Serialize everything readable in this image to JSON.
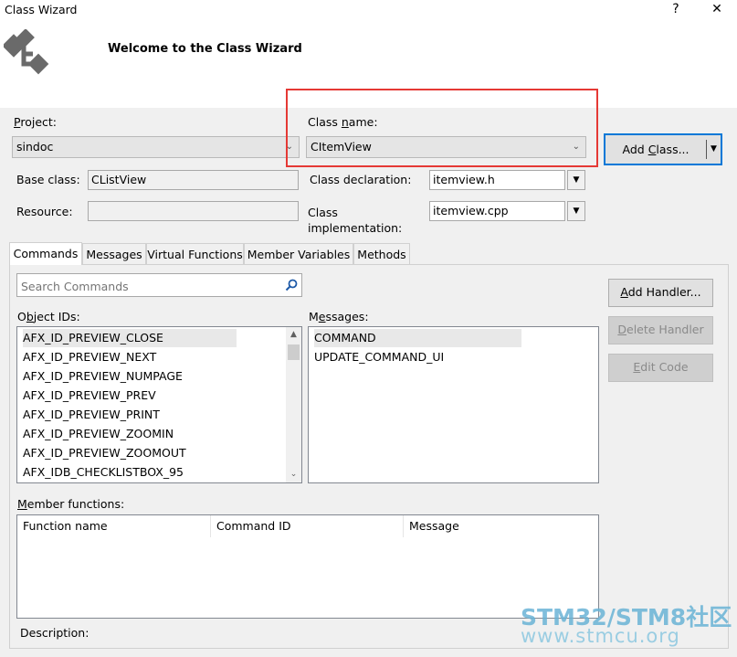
{
  "window": {
    "title": "Class Wizard",
    "help_glyph": "?",
    "close_glyph": "✕",
    "welcome": "Welcome to the Class Wizard"
  },
  "project": {
    "label_u": "P",
    "label_rest": "roject:",
    "value": "sindoc"
  },
  "class_name": {
    "label_pre": "Class ",
    "label_u": "n",
    "label_rest": "ame:",
    "value": "CItemView"
  },
  "add_class_button": {
    "label_pre": "Add ",
    "label_u": "C",
    "label_rest": "lass..."
  },
  "base_class": {
    "label": "Base class:",
    "value": "CListView"
  },
  "resource": {
    "label": "Resource:",
    "value": ""
  },
  "class_declaration": {
    "label": "Class declaration:",
    "value": "itemview.h"
  },
  "class_implementation": {
    "label_line1": "Class",
    "label_line2": "implementation:",
    "value": "itemview.cpp"
  },
  "tabs": [
    {
      "label": "Commands"
    },
    {
      "label": "Messages"
    },
    {
      "label": "Virtual Functions"
    },
    {
      "label": "Member Variables"
    },
    {
      "label": "Methods"
    }
  ],
  "search": {
    "placeholder": "Search Commands"
  },
  "object_ids": {
    "label_u": "b",
    "label_pre": "O",
    "label_rest": "ject IDs:",
    "items": [
      "AFX_ID_PREVIEW_CLOSE",
      "AFX_ID_PREVIEW_NEXT",
      "AFX_ID_PREVIEW_NUMPAGE",
      "AFX_ID_PREVIEW_PREV",
      "AFX_ID_PREVIEW_PRINT",
      "AFX_ID_PREVIEW_ZOOMIN",
      "AFX_ID_PREVIEW_ZOOMOUT",
      "AFX_IDB_CHECKLISTBOX_95"
    ]
  },
  "messages": {
    "label_pre": "M",
    "label_u": "e",
    "label_rest": "ssages:",
    "items": [
      "COMMAND",
      "UPDATE_COMMAND_UI"
    ]
  },
  "buttons": {
    "add_handler_u": "A",
    "add_handler_rest": "dd Handler...",
    "delete_handler_u": "D",
    "delete_handler_rest": "elete Handler",
    "edit_code_u": "E",
    "edit_code_rest": "dit Code"
  },
  "member_functions": {
    "label_u": "M",
    "label_rest": "ember functions:",
    "columns": [
      "Function name",
      "Command ID",
      "Message"
    ]
  },
  "description": {
    "label": "Description:"
  },
  "watermark": {
    "line1": "STM32/STM8社区",
    "line2": "www.stmcu.org"
  },
  "colors": {
    "highlight_box": "#e53935",
    "accent_border": "#0078d7"
  }
}
